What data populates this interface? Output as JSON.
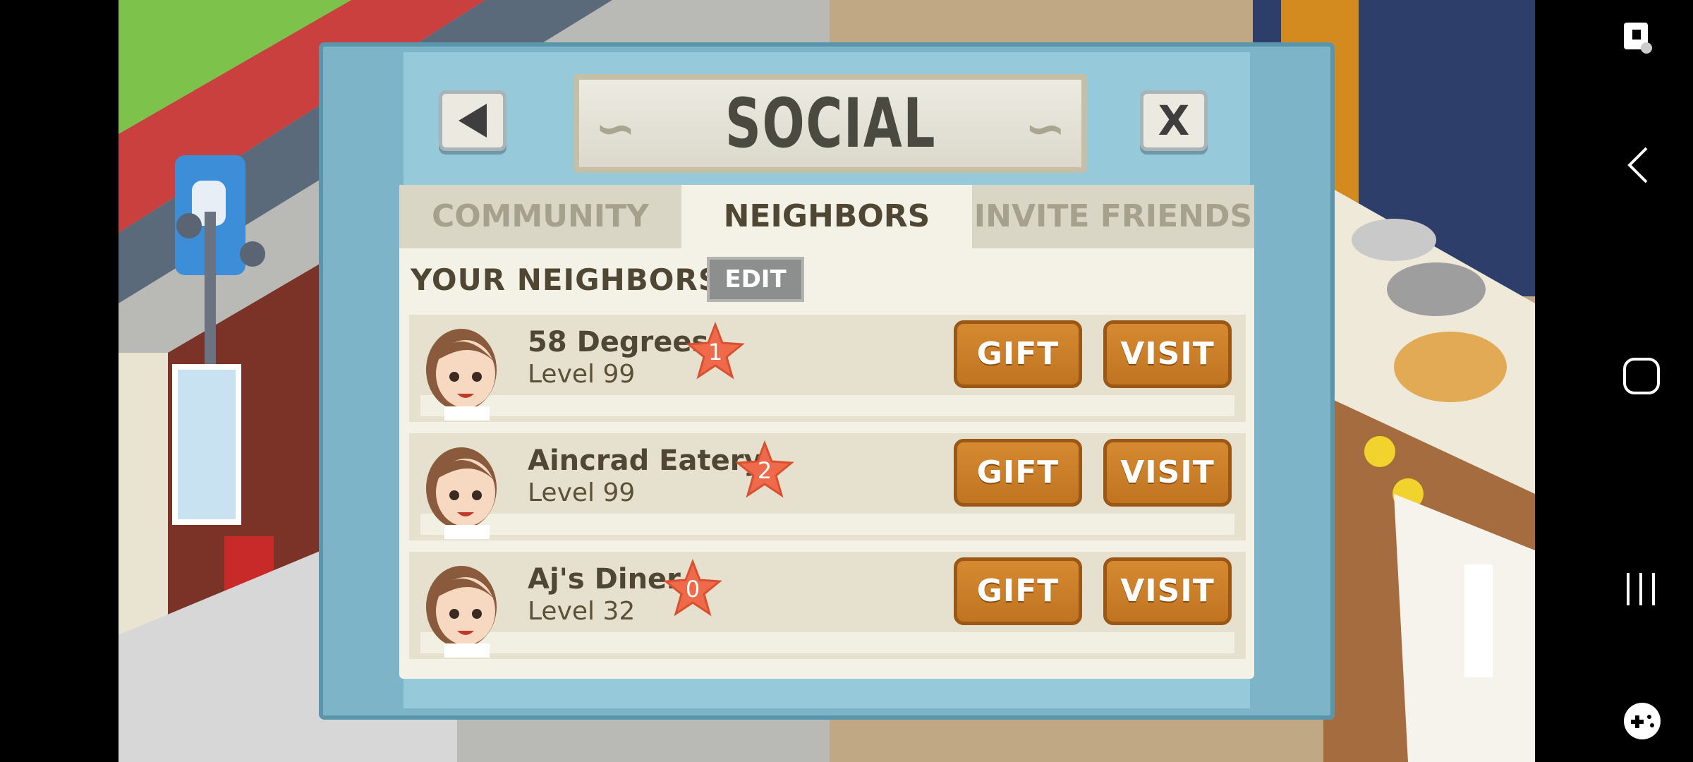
{
  "dialog": {
    "title": "SOCIAL",
    "back_icon": "back-arrow-icon",
    "close_label": "X"
  },
  "tabs": [
    {
      "label": "COMMUNITY",
      "active": false
    },
    {
      "label": "NEIGHBORS",
      "active": true
    },
    {
      "label": "INVITE FRIENDS",
      "active": false
    }
  ],
  "section": {
    "heading": "YOUR NEIGHBORS",
    "edit_label": "EDIT"
  },
  "neighbors": [
    {
      "name": "58 Degrees",
      "level": "Level 99",
      "star": "1",
      "gift_label": "GIFT",
      "visit_label": "VISIT"
    },
    {
      "name": "Aincrad Eatery",
      "level": "Level 99",
      "star": "2",
      "gift_label": "GIFT",
      "visit_label": "VISIT"
    },
    {
      "name": "Aj's Diner",
      "level": "Level 32",
      "star": "0",
      "gift_label": "GIFT",
      "visit_label": "VISIT"
    }
  ],
  "colors": {
    "dialog_blue": "#7db4c8",
    "panel": "#f4f1e6",
    "button_orange": "#c97d27",
    "star": "#ef6a4a",
    "text_brown": "#4f4633"
  },
  "system_bar": {
    "icons": [
      "screen-lock-icon",
      "nav-back-icon",
      "nav-home-icon",
      "nav-recents-icon",
      "game-tools-icon"
    ]
  }
}
